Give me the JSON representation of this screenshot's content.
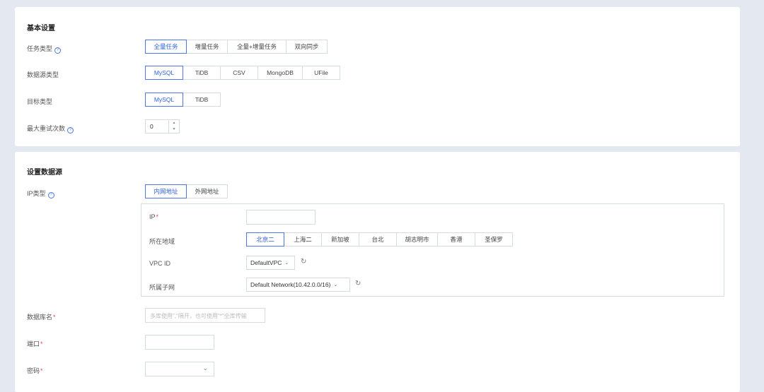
{
  "basic": {
    "title": "基本设置",
    "task_type": {
      "label": "任务类型",
      "options": [
        "全量任务",
        "增量任务",
        "全量+增量任务",
        "双向同步"
      ],
      "selected": "全量任务"
    },
    "source_type": {
      "label": "数据源类型",
      "options": [
        "MySQL",
        "TiDB",
        "CSV",
        "MongoDB",
        "UFile"
      ],
      "selected": "MySQL"
    },
    "target_type": {
      "label": "目标类型",
      "options": [
        "MySQL",
        "TiDB"
      ],
      "selected": "MySQL"
    },
    "max_retry": {
      "label": "最大重试次数",
      "value": "0",
      "up": "▲",
      "down": "▼"
    }
  },
  "source": {
    "title": "设置数据源",
    "ip_type": {
      "label": "IP类型",
      "options": [
        "内网地址",
        "外网地址"
      ],
      "selected": "内网地址"
    },
    "ip": {
      "label": "IP",
      "required": "*",
      "value": ""
    },
    "region": {
      "label": "所在地域",
      "options": [
        "北京二",
        "上海二",
        "新加坡",
        "台北",
        "胡志明市",
        "香港",
        "圣保罗"
      ],
      "selected": "北京二"
    },
    "vpc": {
      "label": "VPC ID",
      "value": "DefaultVPC"
    },
    "subnet": {
      "label": "所属子网",
      "value": "Default Network(10.42.0.0/16)"
    },
    "database": {
      "label": "数据库名",
      "required": "*",
      "placeholder": "多库使用\",\"隔开，也可使用\"*\"全库传输"
    },
    "port": {
      "label": "端口",
      "required": "*",
      "value": ""
    },
    "password": {
      "label": "密码",
      "required": "*",
      "value": ""
    }
  },
  "icons": {
    "help": "?",
    "chevron": "⌄",
    "refresh": "↻",
    "dropdown": "⌄"
  }
}
